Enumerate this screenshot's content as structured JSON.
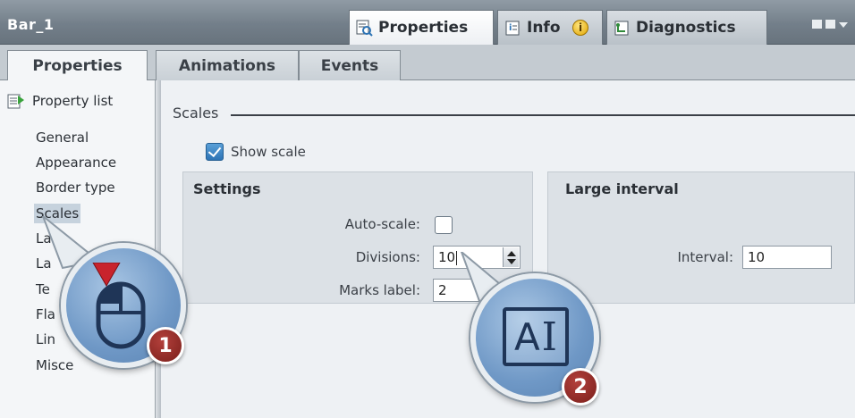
{
  "window": {
    "object_name": "Bar_1"
  },
  "top_tabs": [
    {
      "label": "Properties",
      "icon": "properties-icon",
      "active": true
    },
    {
      "label": "Info",
      "icon": "info-icon",
      "active": false
    },
    {
      "label": "Diagnostics",
      "icon": "diagnostics-icon",
      "active": false
    }
  ],
  "sub_tabs": [
    {
      "label": "Properties",
      "active": true
    },
    {
      "label": "Animations",
      "active": false
    },
    {
      "label": "Events",
      "active": false
    }
  ],
  "nav": {
    "property_list": "Property list",
    "items": [
      "General",
      "Appearance",
      "Border type",
      "Scales",
      "La",
      "La",
      "Te",
      "Fla",
      "Lin",
      "Misce"
    ],
    "selected": "Scales"
  },
  "section": {
    "title": "Scales",
    "show_scale": {
      "label": "Show scale",
      "checked": true
    }
  },
  "settings": {
    "title": "Settings",
    "auto_scale": {
      "label": "Auto-scale:",
      "checked": false
    },
    "divisions": {
      "label": "Divisions:",
      "value": "10"
    },
    "marks_label": {
      "label": "Marks label:",
      "value": "2"
    }
  },
  "large_interval": {
    "title": "Large interval",
    "interval": {
      "label": "Interval:",
      "value": "10"
    }
  },
  "callouts": [
    {
      "number": "1",
      "icon": "mouse-click-icon"
    },
    {
      "number": "2",
      "icon": "text-input-icon",
      "text": "A"
    }
  ],
  "colors": {
    "titlebar": "#737f8a",
    "accent_check": "#2e74b5",
    "badge": "#8b2520",
    "selection": "#c6d2dd"
  }
}
